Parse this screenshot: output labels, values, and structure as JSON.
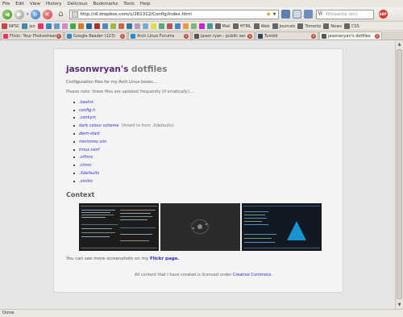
{
  "menu": [
    "File",
    "Edit",
    "View",
    "History",
    "Delicious",
    "Bookmarks",
    "Tools",
    "Help"
  ],
  "toolbar": {
    "url": "http://dl.dropbox.com/u/261312/Config/index.html",
    "search_placeholder": "Wikipedia (en)",
    "search_engine_glyph": "W",
    "adblock_label": "ABP"
  },
  "bookmarks": [
    {
      "label": "NPSC",
      "color": "#c44"
    },
    {
      "label": "jez",
      "color": "#48a"
    },
    {
      "label": "",
      "color": "#e36"
    },
    {
      "label": "",
      "color": "#38c"
    },
    {
      "label": "",
      "color": "#69c"
    },
    {
      "label": "",
      "color": "#c8c"
    },
    {
      "label": "",
      "color": "#4a4"
    },
    {
      "label": "",
      "color": "#d72"
    },
    {
      "label": "",
      "color": "#26a"
    },
    {
      "label": "",
      "color": "#a33"
    },
    {
      "label": "",
      "color": "#58b"
    },
    {
      "label": "",
      "color": "#9b4"
    },
    {
      "label": "",
      "color": "#c64"
    },
    {
      "label": "",
      "color": "#37a"
    },
    {
      "label": "",
      "color": "#b9b"
    },
    {
      "label": "",
      "color": "#7ac"
    },
    {
      "label": "",
      "color": "#dd5"
    },
    {
      "label": "",
      "color": "#5a7"
    },
    {
      "label": "",
      "color": "#b55"
    },
    {
      "label": "",
      "color": "#48c"
    },
    {
      "label": "",
      "color": "#e94"
    },
    {
      "label": "",
      "color": "#7b7"
    },
    {
      "label": "",
      "color": "#c2c"
    },
    {
      "label": "",
      "color": "#499"
    },
    {
      "label": "Mail",
      "color": "#666"
    },
    {
      "label": "HTML",
      "color": "#666"
    },
    {
      "label": "Web",
      "color": "#666"
    },
    {
      "label": "Journals",
      "color": "#666"
    },
    {
      "label": "Torrentz",
      "color": "#666"
    },
    {
      "label": "News",
      "color": "#666"
    },
    {
      "label": "CSS",
      "color": "#666"
    }
  ],
  "tabs": [
    {
      "label": "Flickr: Your Photostream",
      "color": "#e36"
    },
    {
      "label": "Google Reader (123)",
      "color": "#38c"
    },
    {
      "label": "Arch Linux Forums",
      "color": "#1793d1"
    },
    {
      "label": "jason ryan : public ser...",
      "color": "#555"
    },
    {
      "label": "Tumblr",
      "color": "#2c4762"
    },
    {
      "label": "jasonwryan's dotfiles",
      "color": "#555"
    }
  ],
  "page": {
    "title_owner": "jasonwryan's",
    "title_suffix": " dotfiles",
    "subtitle": "Configuration files for my Arch Linux boxes....",
    "note_prefix": "Please note: these files are updated frequently (",
    "note_em": "if erratically",
    "note_suffix": ")....",
    "files": [
      {
        "label": ".bashrc",
        "extra": ""
      },
      {
        "label": "config.h",
        "extra": ""
      },
      {
        "label": ".conkyrc",
        "extra": ""
      },
      {
        "label": "dark colour scheme",
        "extra": "(linked to from .Xdefaults)"
      },
      {
        "label": "dwm-start",
        "extra": ""
      },
      {
        "label": "minimmo.vim",
        "extra": ""
      },
      {
        "label": "tmux.conf",
        "extra": ""
      },
      {
        "label": ".vifmrc",
        "extra": ""
      },
      {
        "label": ".vimrc",
        "extra": ""
      },
      {
        "label": ".Xdefaults",
        "extra": ""
      },
      {
        "label": ".xinitrc",
        "extra": ""
      }
    ],
    "context_heading": "Context",
    "flickr_prefix": "You can see more screenshots on my ",
    "flickr_link": "Flickr page.",
    "license_prefix": "All content that I have created is licensed under ",
    "license_link": "Creative Commons",
    "license_suffix": "."
  },
  "status": "Done"
}
